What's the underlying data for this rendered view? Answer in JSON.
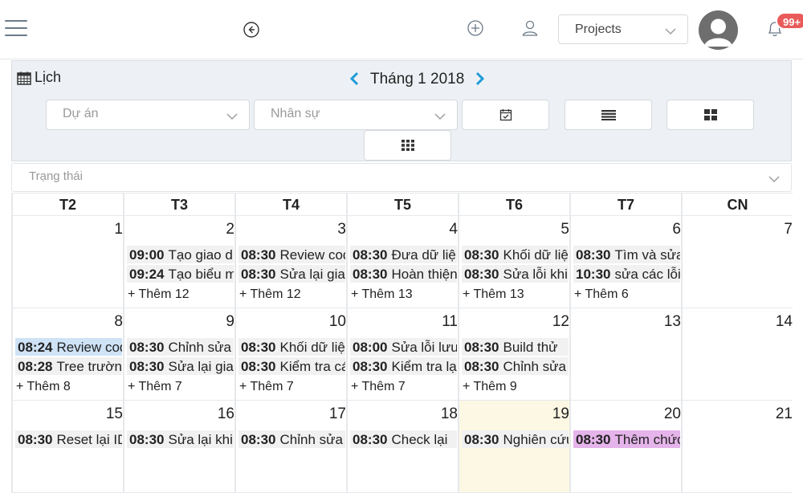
{
  "header": {
    "project_select": "Projects",
    "notification_badge": "99+"
  },
  "filters": {
    "title": "Lịch",
    "month": "Tháng 1 2018",
    "project_placeholder": "Dự án",
    "staff_placeholder": "Nhân sự",
    "status_placeholder": "Trạng thái"
  },
  "calendar": {
    "weekdays": [
      "T2",
      "T3",
      "T4",
      "T5",
      "T6",
      "T7",
      "CN"
    ],
    "weeks": [
      [
        {
          "day": "1",
          "events": [],
          "more": ""
        },
        {
          "day": "2",
          "events": [
            {
              "time": "09:00",
              "title": "Tạo giao diện"
            },
            {
              "time": "09:24",
              "title": "Tạo biểu mẫu"
            }
          ],
          "more": "+ Thêm 12"
        },
        {
          "day": "3",
          "events": [
            {
              "time": "08:30",
              "title": "Review code"
            },
            {
              "time": "08:30",
              "title": "Sửa lại giao"
            }
          ],
          "more": "+ Thêm 12"
        },
        {
          "day": "4",
          "events": [
            {
              "time": "08:30",
              "title": "Đưa dữ liệu"
            },
            {
              "time": "08:30",
              "title": "Hoàn thiện"
            }
          ],
          "more": "+ Thêm 13"
        },
        {
          "day": "5",
          "events": [
            {
              "time": "08:30",
              "title": "Khối dữ liệu"
            },
            {
              "time": "08:30",
              "title": "Sửa lỗi khi"
            }
          ],
          "more": "+ Thêm 13"
        },
        {
          "day": "6",
          "events": [
            {
              "time": "08:30",
              "title": "Tìm và sửa"
            },
            {
              "time": "10:30",
              "title": "sửa các lỗi"
            }
          ],
          "more": "+ Thêm 6"
        },
        {
          "day": "7",
          "events": [],
          "more": ""
        }
      ],
      [
        {
          "day": "8",
          "events": [
            {
              "time": "08:24",
              "title": "Review code",
              "color": "blue"
            },
            {
              "time": "08:28",
              "title": "Tree trường"
            }
          ],
          "more": "+ Thêm 8"
        },
        {
          "day": "9",
          "events": [
            {
              "time": "08:30",
              "title": "Chỉnh sửa"
            },
            {
              "time": "08:30",
              "title": "Sửa lại giao"
            }
          ],
          "more": "+ Thêm 7"
        },
        {
          "day": "10",
          "events": [
            {
              "time": "08:30",
              "title": "Khối dữ liệu"
            },
            {
              "time": "08:30",
              "title": "Kiểm tra các"
            }
          ],
          "more": "+ Thêm 7"
        },
        {
          "day": "11",
          "events": [
            {
              "time": "08:00",
              "title": "Sửa lỗi lưu"
            },
            {
              "time": "08:30",
              "title": "Kiểm tra lại"
            }
          ],
          "more": "+ Thêm 7"
        },
        {
          "day": "12",
          "events": [
            {
              "time": "08:30",
              "title": "Build thử"
            },
            {
              "time": "08:30",
              "title": "Chỉnh sửa"
            }
          ],
          "more": "+ Thêm 9"
        },
        {
          "day": "13",
          "events": [],
          "more": ""
        },
        {
          "day": "14",
          "events": [],
          "more": ""
        }
      ],
      [
        {
          "day": "15",
          "events": [
            {
              "time": "08:30",
              "title": "Reset lại ID"
            }
          ],
          "more": ""
        },
        {
          "day": "16",
          "events": [
            {
              "time": "08:30",
              "title": "Sửa lại khi"
            }
          ],
          "more": ""
        },
        {
          "day": "17",
          "events": [
            {
              "time": "08:30",
              "title": "Chỉnh sửa"
            }
          ],
          "more": ""
        },
        {
          "day": "18",
          "events": [
            {
              "time": "08:30",
              "title": "Check lại"
            }
          ],
          "more": ""
        },
        {
          "day": "19",
          "events": [
            {
              "time": "08:30",
              "title": "Nghiên cứu"
            }
          ],
          "more": "",
          "today": true
        },
        {
          "day": "20",
          "events": [
            {
              "time": "08:30",
              "title": "Thêm chức",
              "color": "purple"
            }
          ],
          "more": ""
        },
        {
          "day": "21",
          "events": [],
          "more": ""
        }
      ]
    ]
  },
  "colors": {
    "accent": "#1e9bd7",
    "badge": "#e95b5b",
    "panel": "#edf1f5",
    "today": "#fcf8e3",
    "event_default": "#f1f1f1",
    "event_blue": "#cfe3f7",
    "event_purple": "#e5b4ea"
  },
  "icons": [
    "menu-icon",
    "back-icon",
    "add-icon",
    "user-icon",
    "chevron-down-icon",
    "avatar-icon",
    "bell-icon",
    "calendar-icon",
    "list-icon",
    "grid-icon",
    "apps-icon",
    "chevron-left-icon",
    "chevron-right-icon"
  ]
}
